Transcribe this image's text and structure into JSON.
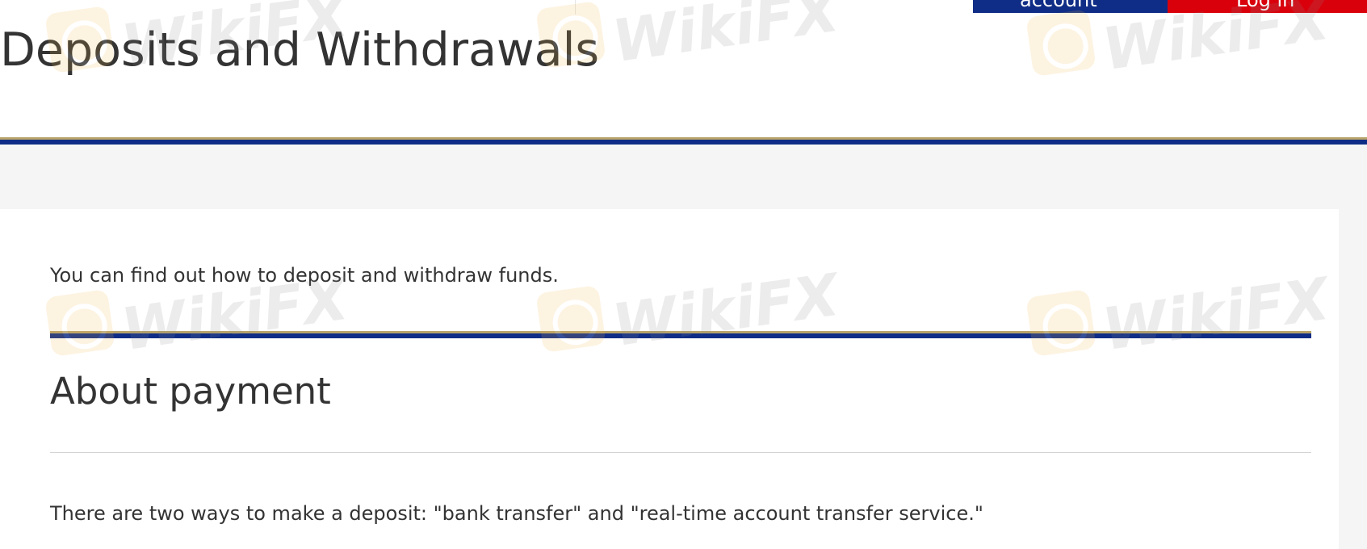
{
  "header": {
    "open_account_label": "account",
    "login_label": "Log in"
  },
  "page": {
    "title": "Deposits and Withdrawals",
    "intro": "You can find out how to deposit and withdraw funds."
  },
  "section": {
    "title": "About payment",
    "body": "There are two ways to make a deposit: \"bank transfer\" and \"real-time account transfer service.\""
  },
  "watermark": {
    "text": "WikiFX"
  },
  "colors": {
    "navy": "#0f2d86",
    "red": "#d9000c",
    "gold": "#b8a36a",
    "band_gray": "#f5f5f5",
    "text": "#333333"
  }
}
